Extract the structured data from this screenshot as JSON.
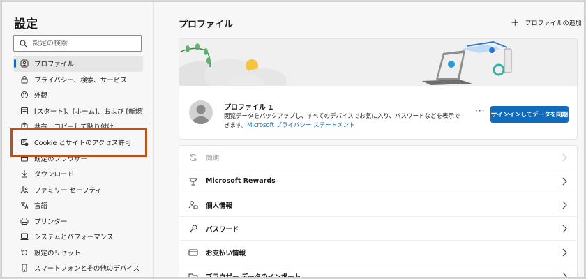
{
  "sidebar": {
    "title": "設定",
    "search_placeholder": "設定の検索",
    "items": [
      {
        "label": "プロファイル",
        "icon": "profile-icon",
        "active": true
      },
      {
        "label": "プライバシー、検索、サービス",
        "icon": "lock-icon"
      },
      {
        "label": "外観",
        "icon": "appearance-icon"
      },
      {
        "label": "[スタート]、[ホーム]、および [新規] タブ",
        "icon": "tabs-icon"
      },
      {
        "label": "共有、コピーして貼り付け",
        "icon": "share-icon"
      },
      {
        "label": "Cookie とサイトのアクセス許可",
        "icon": "cookie-permissions-icon",
        "highlighted": true
      },
      {
        "label": "既定のブラウザー",
        "icon": "browser-icon"
      },
      {
        "label": "ダウンロード",
        "icon": "download-icon"
      },
      {
        "label": "ファミリー セーフティ",
        "icon": "family-icon"
      },
      {
        "label": "言語",
        "icon": "language-icon"
      },
      {
        "label": "プリンター",
        "icon": "printer-icon"
      },
      {
        "label": "システムとパフォーマンス",
        "icon": "system-icon"
      },
      {
        "label": "設定のリセット",
        "icon": "reset-icon"
      },
      {
        "label": "スマートフォンとその他のデバイス",
        "icon": "phone-icon"
      }
    ]
  },
  "main": {
    "title": "プロファイル",
    "add_profile_label": "プロファイルの追加",
    "profile": {
      "name": "プロファイル 1",
      "description": "閲覧データをバックアップし、すべてのデバイスでお気に入り、パスワードなどを表示できます。",
      "link": "Microsoft プライバシー ステートメント",
      "more_label": "···",
      "sync_button": "サインインしてデータを同期"
    },
    "rows": [
      {
        "label": "同期",
        "icon": "sync-icon",
        "disabled": true
      },
      {
        "label": "Microsoft Rewards",
        "icon": "rewards-icon"
      },
      {
        "label": "個人情報",
        "icon": "personal-info-icon"
      },
      {
        "label": "パスワード",
        "icon": "key-icon"
      },
      {
        "label": "お支払い情報",
        "icon": "card-icon"
      },
      {
        "label": "ブラウザー データのインポート",
        "icon": "import-icon"
      }
    ]
  },
  "colors": {
    "accent": "#0f6cbd",
    "highlight_border": "#b8521c"
  }
}
